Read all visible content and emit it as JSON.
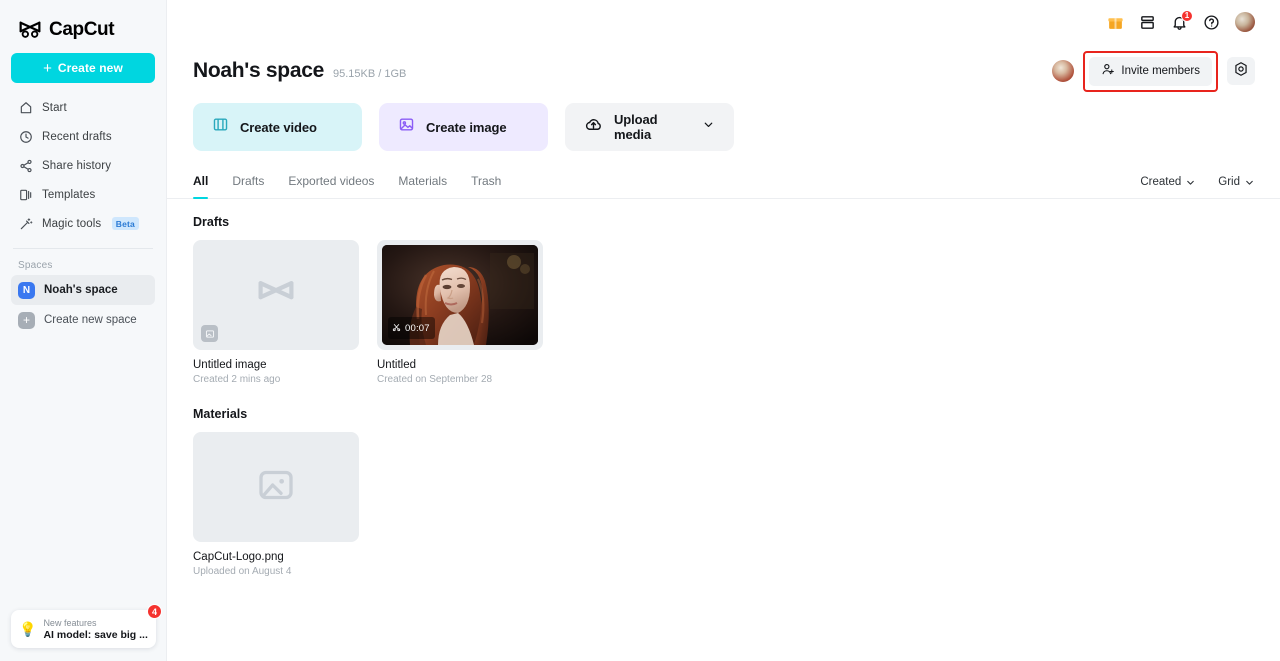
{
  "brand": {
    "name": "CapCut",
    "accent": "#00d6e0",
    "highlight": "#e8241d"
  },
  "sidebar": {
    "create_new_label": "Create new",
    "items": [
      {
        "label": "Start",
        "icon": "home-icon"
      },
      {
        "label": "Recent drafts",
        "icon": "clock-icon"
      },
      {
        "label": "Share history",
        "icon": "share-icon"
      },
      {
        "label": "Templates",
        "icon": "templates-icon"
      },
      {
        "label": "Magic tools",
        "icon": "magic-wand-icon",
        "badge": "Beta"
      }
    ],
    "spaces_caption": "Spaces",
    "spaces": [
      {
        "label": "Noah's space",
        "initial": "N",
        "active": true
      },
      {
        "label": "Create new space",
        "initial": "+",
        "active": false
      }
    ],
    "promo": {
      "eyebrow": "New features",
      "title": "AI model: save big ...",
      "badge": "4",
      "icon": "lightbulb-icon"
    }
  },
  "topbar": {
    "icons": [
      {
        "name": "gift-icon"
      },
      {
        "name": "archive-icon"
      },
      {
        "name": "bell-icon",
        "badge": "1"
      },
      {
        "name": "help-icon"
      }
    ],
    "avatar_name": "user-avatar"
  },
  "header": {
    "title": "Noah's space",
    "storage": "95.15KB / 1GB",
    "invite_label": "Invite members",
    "settings_icon": "gear-icon"
  },
  "actions": [
    {
      "label": "Create video",
      "icon": "film-icon",
      "bg": "#d8f4f8"
    },
    {
      "label": "Create image",
      "icon": "image-icon",
      "bg": "#eeeaff"
    },
    {
      "label": "Upload media",
      "icon": "cloud-upload-icon",
      "bg": "#f2f3f5",
      "chevron": true
    }
  ],
  "tabs": [
    {
      "label": "All",
      "active": true
    },
    {
      "label": "Drafts",
      "active": false
    },
    {
      "label": "Exported videos",
      "active": false
    },
    {
      "label": "Materials",
      "active": false
    },
    {
      "label": "Trash",
      "active": false
    }
  ],
  "tabs_right": [
    {
      "label": "Created"
    },
    {
      "label": "Grid"
    }
  ],
  "sections": [
    {
      "title": "Drafts",
      "cards": [
        {
          "name": "Untitled image",
          "sub": "Created 2 mins ago",
          "kind": "placeholder-logo",
          "badge_icon": "image-icon"
        },
        {
          "name": "Untitled",
          "sub": "Created on September 28",
          "kind": "video",
          "duration": "00:07",
          "duration_icon": "scissors-icon"
        }
      ]
    },
    {
      "title": "Materials",
      "cards": [
        {
          "name": "CapCut-Logo.png",
          "sub": "Uploaded on August 4",
          "kind": "placeholder-image"
        }
      ]
    }
  ]
}
